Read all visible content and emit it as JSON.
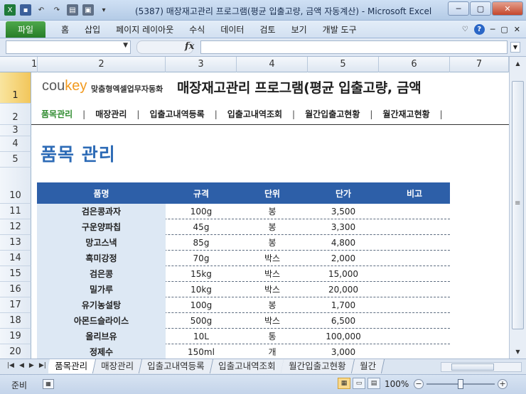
{
  "window": {
    "title": "(5387) 매장재고관리 프로그램(평균 입출고량, 금액 자동계산) - Microsoft Excel",
    "controls": [
      "─",
      "▢",
      "✕"
    ]
  },
  "ribbon": {
    "file_tab": "파일",
    "tabs": [
      "홈",
      "삽입",
      "페이지 레이아웃",
      "수식",
      "데이터",
      "검토",
      "보기",
      "개발 도구"
    ]
  },
  "formula_bar": {
    "name_box": "",
    "fx": "fx",
    "formula": ""
  },
  "columns": [
    "1",
    "2",
    "3",
    "4",
    "5",
    "6",
    "7"
  ],
  "rows": [
    "1",
    "2",
    "3",
    "4",
    "5",
    "10",
    "11",
    "12",
    "13",
    "14",
    "15",
    "16",
    "17",
    "18",
    "19",
    "20"
  ],
  "brand": {
    "logo_co": "cou",
    "logo_key": "key",
    "logo_sub": "맞춤형엑셀업무자동화"
  },
  "app_title": "매장재고관리 프로그램(평균 입출고량, 금액",
  "nav": {
    "items": [
      "품목관리",
      "매장관리",
      "입출고내역등록",
      "입출고내역조회",
      "월간입출고현황",
      "월간재고현황"
    ],
    "active_index": 0
  },
  "page_title": "품목 관리",
  "table": {
    "headers": [
      "품명",
      "규격",
      "단위",
      "단가",
      "비고"
    ],
    "rows": [
      [
        "검은콩과자",
        "100g",
        "봉",
        "3,500",
        ""
      ],
      [
        "구운양파칩",
        "45g",
        "봉",
        "3,300",
        ""
      ],
      [
        "망고스낵",
        "85g",
        "봉",
        "4,800",
        ""
      ],
      [
        "흑미강정",
        "70g",
        "박스",
        "2,000",
        ""
      ],
      [
        "검은콩",
        "15kg",
        "박스",
        "15,000",
        ""
      ],
      [
        "밀가루",
        "10kg",
        "박스",
        "20,000",
        ""
      ],
      [
        "유기농설탕",
        "100g",
        "봉",
        "1,700",
        ""
      ],
      [
        "아몬드슬라이스",
        "500g",
        "박스",
        "6,500",
        ""
      ],
      [
        "올리브유",
        "10L",
        "통",
        "100,000",
        ""
      ],
      [
        "정제수",
        "150ml",
        "개",
        "3,000",
        ""
      ]
    ]
  },
  "sheet_tabs": {
    "tabs": [
      "품목관리",
      "매장관리",
      "입출고내역등록",
      "입출고내역조회",
      "월간입출고현황",
      "월간"
    ],
    "active_index": 0
  },
  "status": {
    "ready": "준비",
    "zoom": "100%"
  }
}
